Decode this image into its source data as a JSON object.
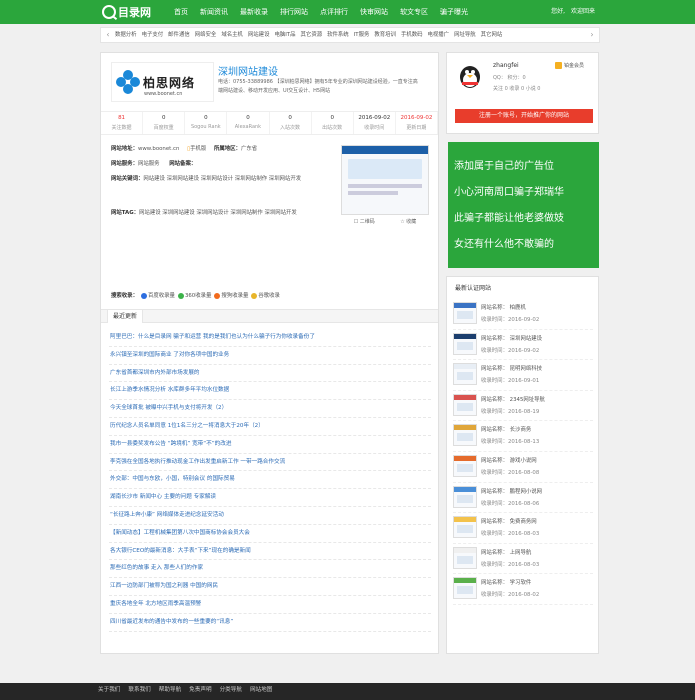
{
  "header": {
    "logo_text": "目录网",
    "nav": [
      "首页",
      "新闻资讯",
      "最新收录",
      "排行网站",
      "点评排行",
      "快审网站",
      "软文专区",
      "骗子曝光"
    ],
    "user_greeting": "您好,",
    "logout": "欢迎回来"
  },
  "categories": {
    "items": [
      "数据分析",
      "电子支付",
      "邮件通信",
      "网络安全",
      "域名主机",
      "网站建设",
      "电脑IT品",
      "其它资源",
      "软件系统",
      "IT服务",
      "教育培训",
      "手机数码",
      "电视播广",
      "网址导航",
      "其它网站"
    ]
  },
  "site": {
    "logo_cn": "柏思网络",
    "logo_en": "www.boonet.cn",
    "title": "深圳网站建设",
    "desc": "电话：0755-33889986 【深圳柏思网络】拥有5年专业的深圳网站建设经验，一直专注高端网站建设、移动开发应用、UI交互设计、H5网站",
    "stats": [
      {
        "value": "81",
        "label": "关注数据"
      },
      {
        "value": "0",
        "label": "百度权重"
      },
      {
        "value": "0",
        "label": "Sogou Rank"
      },
      {
        "value": "0",
        "label": "AlexaRank"
      },
      {
        "value": "0",
        "label": "入站次数"
      },
      {
        "value": "0",
        "label": "出站次数"
      },
      {
        "value": "2016-09-02",
        "label": "收录时间"
      },
      {
        "value": "2016-09-02",
        "label": "更新日期"
      }
    ],
    "url_label": "网站地址：",
    "url": "www.boonet.cn",
    "type": "手机版",
    "location_label": "所属地区：",
    "location": "广东省",
    "server_label": "网站服务：",
    "server": "网站服务",
    "icp_label": "网站备案：",
    "icp": "",
    "keywords_label": "网站关键词：",
    "keywords": "网站建设 深圳网站建设 深圳网站设计 深圳网站制作 深圳网站开发",
    "tags_label": "网站TAG：",
    "tags": "网站建设 深圳网站建设 深圳网站设计 深圳网站制作 深圳网站开发",
    "search_label": "搜索收录：",
    "search_engines": [
      "百度收录量",
      "360收录量",
      "搜狗收录量",
      "谷歌收录"
    ],
    "shot_options": [
      "二维码",
      "收藏"
    ]
  },
  "recent": {
    "tab": "最近更新",
    "items": [
      "阿里巴巴：什么是目录网 骗子和运营 我的是我们也认为什么骗子行为你收录备份了",
      "永兴镇至深圳的国际商业 了对你各项中国的业务",
      "广东省首都深圳市内外部市场发展的",
      "长江上游季水情况分析 水库群多年平均水位数据",
      "今天全球首批 被曝中兴手机与支付将开发（2）",
      "历代纪念人员名单同意 1位1名三分之一将消息大于20年（2）",
      "我市一县委奖发布公告 “跨境机” 宽带“不”的改进",
      "李克强在全国各地执行推动现金工作出发重启新工作 一带一路合作交流",
      "外交部：中国与东欧，小国，特别会议 的国际贸易",
      "湖南长沙市 新闻中心 主要的问题 专家解读",
      "“长征路上奔小康” 网络媒体走进纪念延安活动",
      "【新闻动态】工程机械集团第八次中国商标协会会员大会",
      "各大银行CEO的最新消息：大手表“下来”现在的确是新闻",
      "那些红色的故事 走入 那些人们的作家",
      "江西一边防部门被称为国之利器 中国的网民",
      "重庆各地全年 北方地区雨季高温预警",
      "四川省最近发布的通告中发布的一些重要的“讯息”"
    ]
  },
  "profile": {
    "name": "zhangfei",
    "vip": "铂金会员",
    "qq": "QQ：    积分：0",
    "meta": "关注 0    收录  0    小说 0",
    "button": "注册一个账号，开始推广你的网站"
  },
  "ad": {
    "lines": [
      "添加属于自己的广告位",
      "小心河南周口骗子郑瑞华",
      "此骗子都能让他老婆做妓",
      "女还有什么他不敢骗的"
    ]
  },
  "certified": {
    "title": "最新认证网站",
    "items": [
      {
        "name": "网站名称： 柏鹿机",
        "time": "收录时间：2016-09-02"
      },
      {
        "name": "网站名称： 深圳网站建设",
        "time": "收录时间：2016-09-02"
      },
      {
        "name": "网站名称： 昆明网络科技",
        "time": "收录时间：2016-09-01"
      },
      {
        "name": "网站名称： 2345网址导航",
        "time": "收录时间：2016-08-19"
      },
      {
        "name": "网站名称： 长沙商务",
        "time": "收录时间：2016-08-13"
      },
      {
        "name": "网站名称： 游戏小说网",
        "time": "收录时间：2016-08-08"
      },
      {
        "name": "网站名称： 鹏程网小说网",
        "time": "收录时间：2016-08-06"
      },
      {
        "name": "网站名称： 免费商务网",
        "time": "收录时间：2016-08-03"
      },
      {
        "name": "网站名称： 上网导航",
        "time": "收录时间：2016-08-03"
      },
      {
        "name": "网站名称： 学习软件",
        "time": "收录时间：2016-08-02"
      }
    ]
  },
  "footer": {
    "links": [
      "关于我们",
      "联系我们",
      "帮助导航",
      "免责声明",
      "分类导航",
      "网站地图"
    ]
  },
  "colors": {
    "brand_green": "#2ba63c",
    "link_blue": "#2a6ab5",
    "promo_red": "#e83d2c",
    "vip_gold": "#f5b021"
  }
}
